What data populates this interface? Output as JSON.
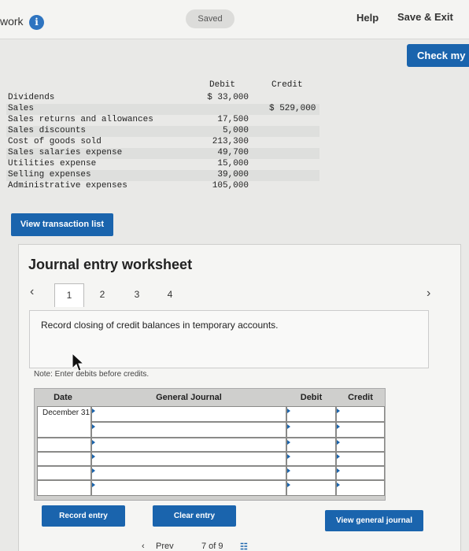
{
  "header": {
    "title": "work",
    "saved_label": "Saved",
    "help_label": "Help",
    "save_exit_label": "Save & Exit",
    "check_label": "Check my"
  },
  "trial_balance": {
    "debit_header": "Debit",
    "credit_header": "Credit",
    "rows": [
      {
        "account": "Dividends",
        "debit": "$ 33,000",
        "credit": ""
      },
      {
        "account": "Sales",
        "debit": "",
        "credit": "$ 529,000"
      },
      {
        "account": "Sales returns and allowances",
        "debit": "17,500",
        "credit": ""
      },
      {
        "account": "Sales discounts",
        "debit": "5,000",
        "credit": ""
      },
      {
        "account": "Cost of goods sold",
        "debit": "213,300",
        "credit": ""
      },
      {
        "account": "Sales salaries expense",
        "debit": "49,700",
        "credit": ""
      },
      {
        "account": "Utilities expense",
        "debit": "15,000",
        "credit": ""
      },
      {
        "account": "Selling expenses",
        "debit": "39,000",
        "credit": ""
      },
      {
        "account": "Administrative expenses",
        "debit": "105,000",
        "credit": ""
      }
    ]
  },
  "view_transaction_label": "View transaction list",
  "worksheet": {
    "title": "Journal entry worksheet",
    "tabs": [
      "1",
      "2",
      "3",
      "4"
    ],
    "active_tab": 0,
    "prompt": "Record closing of credit balances in temporary accounts.",
    "note": "Note: Enter debits before credits.",
    "columns": {
      "date": "Date",
      "general_journal": "General Journal",
      "debit": "Debit",
      "credit": "Credit"
    },
    "date_value": "December 31"
  },
  "buttons": {
    "record": "Record entry",
    "clear": "Clear entry",
    "view_general": "View general journal"
  },
  "pager": {
    "prev": "Prev",
    "position": "7 of 9"
  },
  "colors": {
    "accent": "#1a64ad"
  }
}
